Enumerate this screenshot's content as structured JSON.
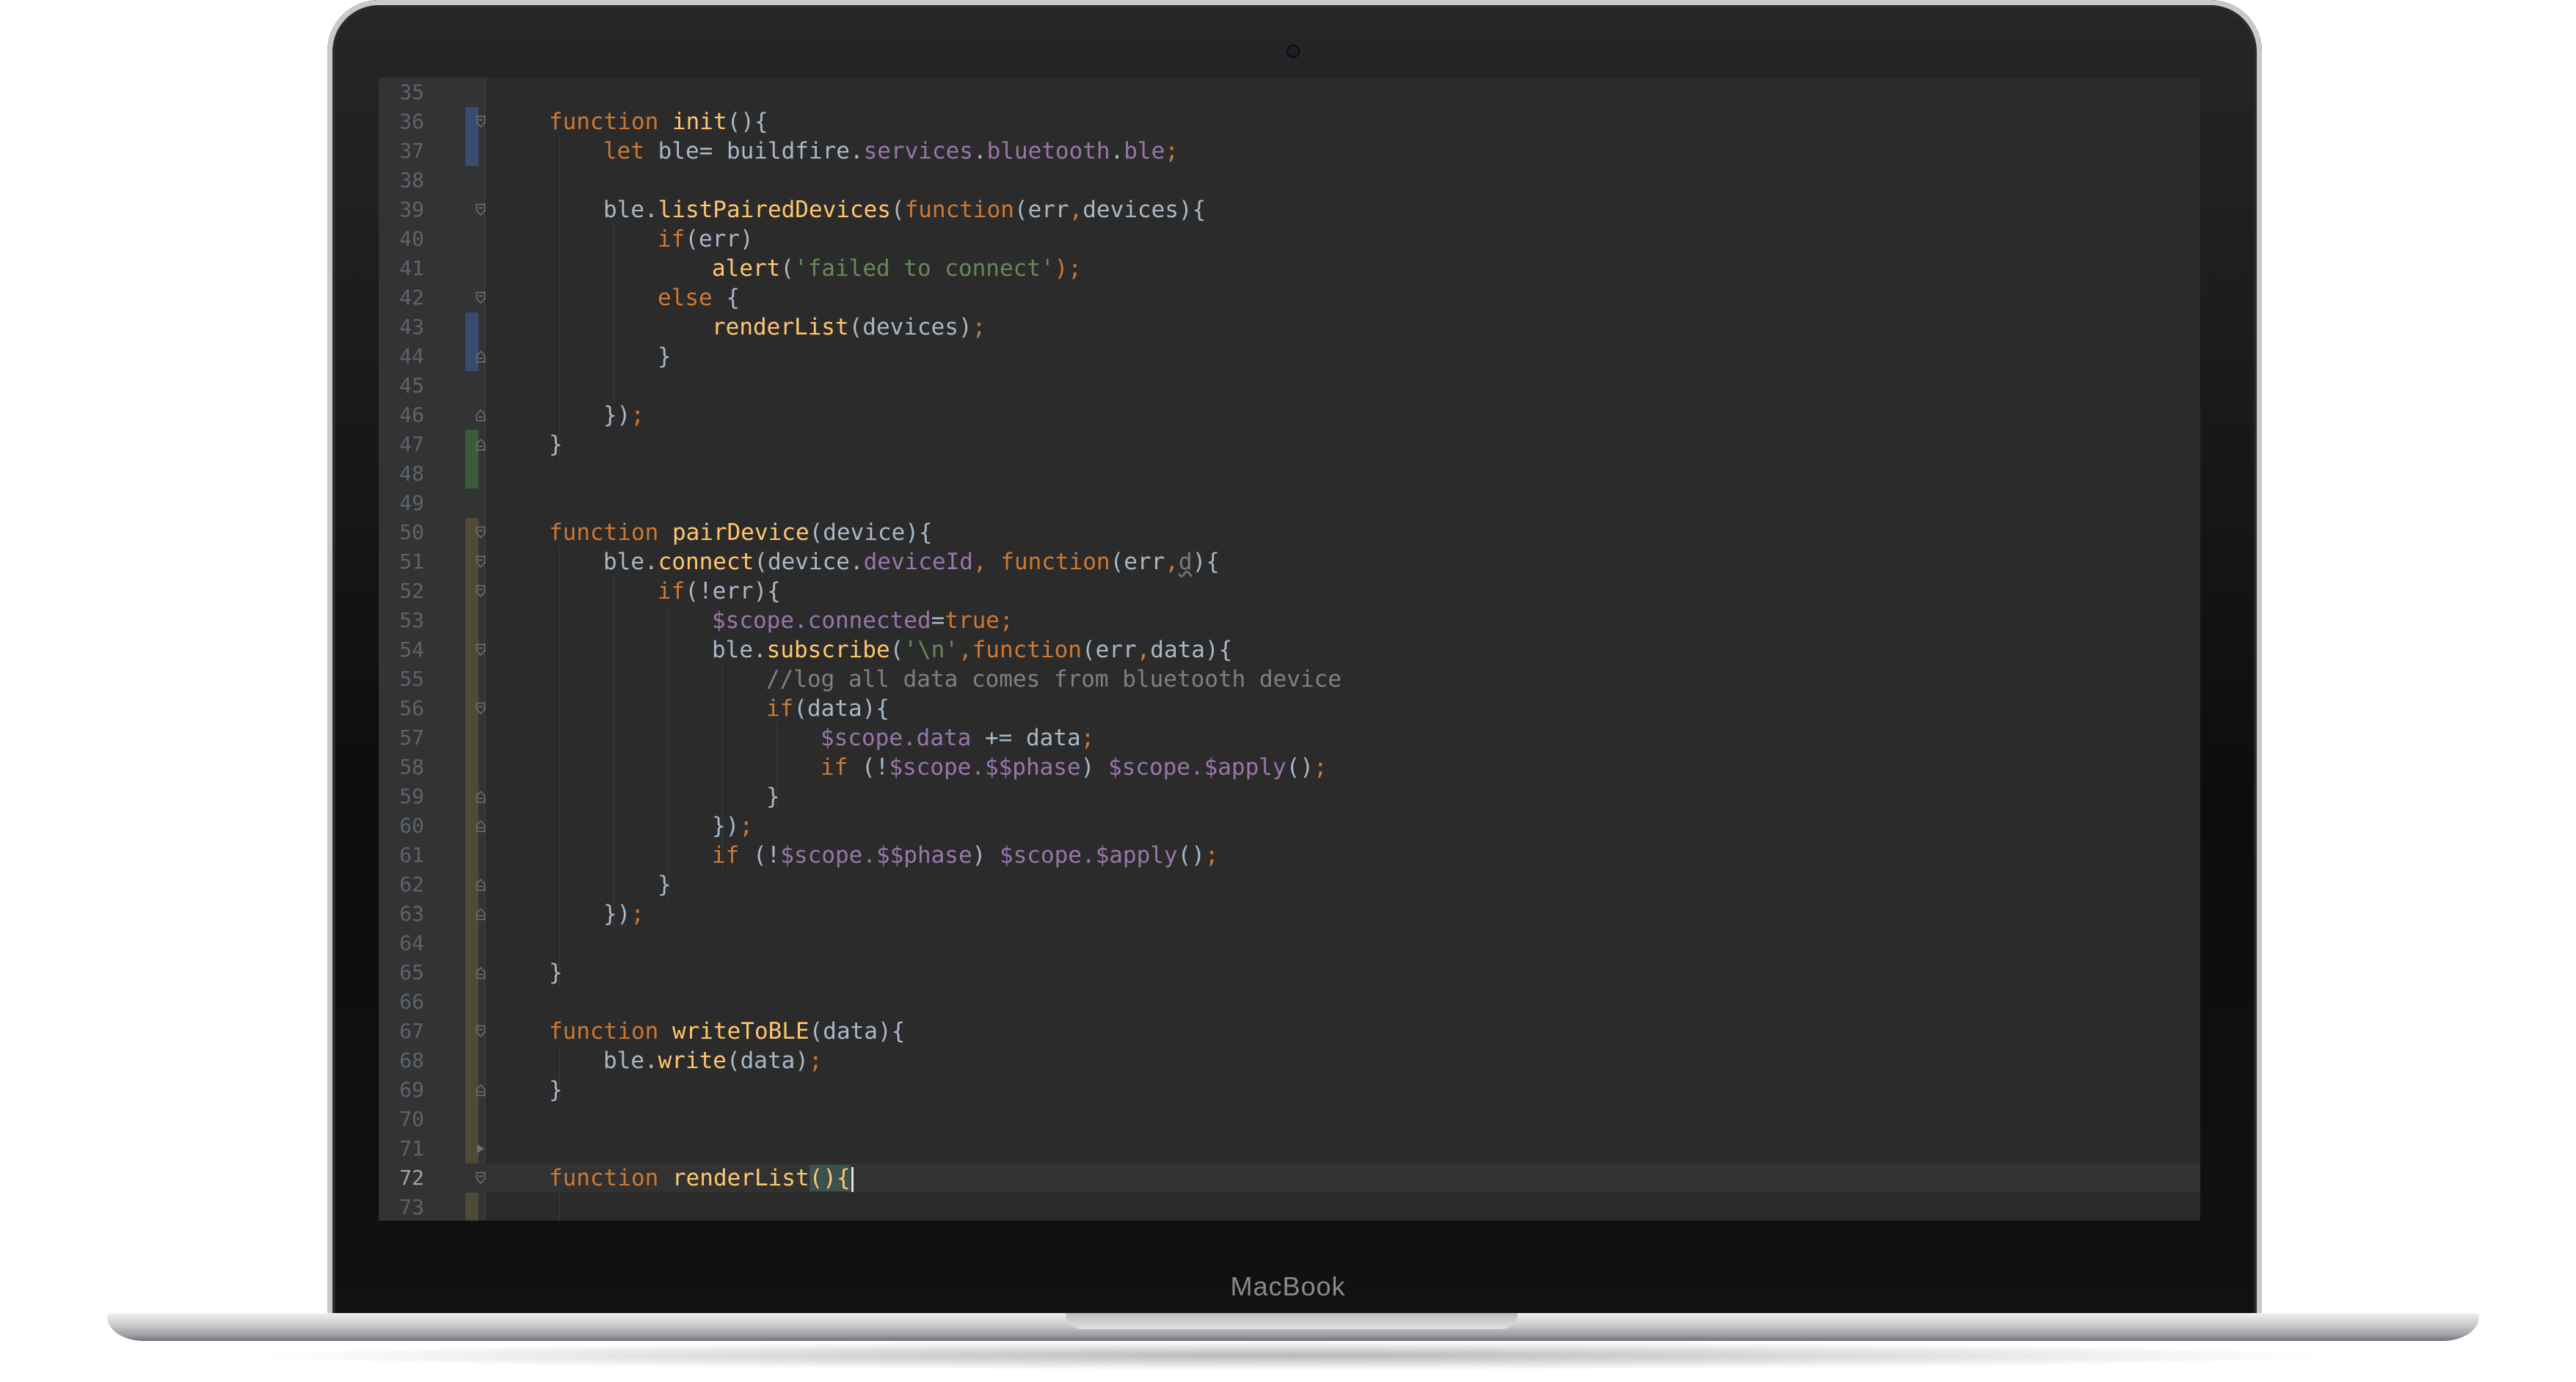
{
  "device": {
    "brand_label": "MacBook"
  },
  "editor": {
    "current_line": 72,
    "colors": {
      "background": "#2b2b2b",
      "keyword": "#cc7832",
      "function_name": "#ffc66d",
      "identifier": "#a9b7c6",
      "property": "#9876aa",
      "string": "#6a8759",
      "comment": "#808080"
    },
    "lines": [
      {
        "n": "35",
        "tokens": []
      },
      {
        "n": "36",
        "indent": 0,
        "fold": "open",
        "tokens": [
          {
            "t": "function ",
            "c": "kw"
          },
          {
            "t": "init",
            "c": "fn"
          },
          {
            "t": "(){",
            "c": "pl"
          }
        ]
      },
      {
        "n": "37",
        "indent": 1,
        "tokens": [
          {
            "t": "let ",
            "c": "kw"
          },
          {
            "t": "ble= buildfire.",
            "c": "pl"
          },
          {
            "t": "services",
            "c": "pr"
          },
          {
            "t": ".",
            "c": "pl"
          },
          {
            "t": "bluetooth",
            "c": "pr"
          },
          {
            "t": ".",
            "c": "pl"
          },
          {
            "t": "ble",
            "c": "pr"
          },
          {
            "t": ";",
            "c": "kw"
          }
        ]
      },
      {
        "n": "38",
        "tokens": []
      },
      {
        "n": "39",
        "indent": 1,
        "fold": "open",
        "tokens": [
          {
            "t": "ble.",
            "c": "pl"
          },
          {
            "t": "listPairedDevices",
            "c": "fn"
          },
          {
            "t": "(",
            "c": "pl"
          },
          {
            "t": "function",
            "c": "kw"
          },
          {
            "t": "(err",
            "c": "pl"
          },
          {
            "t": ",",
            "c": "kw"
          },
          {
            "t": "devices){",
            "c": "pl"
          }
        ]
      },
      {
        "n": "40",
        "indent": 2,
        "tokens": [
          {
            "t": "if",
            "c": "kw"
          },
          {
            "t": "(err)",
            "c": "pl"
          }
        ]
      },
      {
        "n": "41",
        "indent": 3,
        "tokens": [
          {
            "t": "alert",
            "c": "fn"
          },
          {
            "t": "(",
            "c": "pl"
          },
          {
            "t": "'failed to connect'",
            "c": "st"
          },
          {
            "t": ");",
            "c": "kw"
          }
        ]
      },
      {
        "n": "42",
        "indent": 2,
        "fold": "open",
        "tokens": [
          {
            "t": "else ",
            "c": "kw"
          },
          {
            "t": "{",
            "c": "pl"
          }
        ]
      },
      {
        "n": "43",
        "indent": 3,
        "tokens": [
          {
            "t": "renderList",
            "c": "fn"
          },
          {
            "t": "(devices)",
            "c": "pl"
          },
          {
            "t": ";",
            "c": "kw"
          }
        ]
      },
      {
        "n": "44",
        "indent": 2,
        "fold": "close",
        "tokens": [
          {
            "t": "}",
            "c": "pl"
          }
        ]
      },
      {
        "n": "45",
        "tokens": []
      },
      {
        "n": "46",
        "indent": 1,
        "fold": "close",
        "tokens": [
          {
            "t": "})",
            "c": "pl"
          },
          {
            "t": ";",
            "c": "kw"
          }
        ]
      },
      {
        "n": "47",
        "indent": 0,
        "fold": "close",
        "tokens": [
          {
            "t": "}",
            "c": "pl"
          }
        ]
      },
      {
        "n": "48",
        "tokens": []
      },
      {
        "n": "49",
        "tokens": []
      },
      {
        "n": "50",
        "indent": 0,
        "fold": "open",
        "tokens": [
          {
            "t": "function ",
            "c": "kw"
          },
          {
            "t": "pairDevice",
            "c": "fn"
          },
          {
            "t": "(device){",
            "c": "pl"
          }
        ]
      },
      {
        "n": "51",
        "indent": 1,
        "fold": "open",
        "tokens": [
          {
            "t": "ble.",
            "c": "pl"
          },
          {
            "t": "connect",
            "c": "fn"
          },
          {
            "t": "(device.",
            "c": "pl"
          },
          {
            "t": "deviceId",
            "c": "pr"
          },
          {
            "t": ", ",
            "c": "kw"
          },
          {
            "t": "function",
            "c": "kw"
          },
          {
            "t": "(err",
            "c": "pl"
          },
          {
            "t": ",",
            "c": "kw"
          },
          {
            "t": "d",
            "c": "dim"
          },
          {
            "t": "){",
            "c": "pl"
          }
        ]
      },
      {
        "n": "52",
        "indent": 2,
        "fold": "open",
        "tokens": [
          {
            "t": "if",
            "c": "kw"
          },
          {
            "t": "(!err){",
            "c": "pl"
          }
        ]
      },
      {
        "n": "53",
        "indent": 3,
        "tokens": [
          {
            "t": "$scope.",
            "c": "pr"
          },
          {
            "t": "connected",
            "c": "pr"
          },
          {
            "t": "=",
            "c": "pl"
          },
          {
            "t": "true",
            "c": "kw"
          },
          {
            "t": ";",
            "c": "kw"
          }
        ]
      },
      {
        "n": "54",
        "indent": 3,
        "fold": "open",
        "tokens": [
          {
            "t": "ble.",
            "c": "pl"
          },
          {
            "t": "subscribe",
            "c": "fn"
          },
          {
            "t": "(",
            "c": "pl"
          },
          {
            "t": "'\\n'",
            "c": "st"
          },
          {
            "t": ",",
            "c": "kw"
          },
          {
            "t": "function",
            "c": "kw"
          },
          {
            "t": "(err",
            "c": "pl"
          },
          {
            "t": ",",
            "c": "kw"
          },
          {
            "t": "data){",
            "c": "pl"
          }
        ]
      },
      {
        "n": "55",
        "indent": 4,
        "tokens": [
          {
            "t": "//log all data comes from bluetooth device",
            "c": "cm"
          }
        ]
      },
      {
        "n": "56",
        "indent": 4,
        "fold": "open",
        "tokens": [
          {
            "t": "if",
            "c": "kw"
          },
          {
            "t": "(data){",
            "c": "pl"
          }
        ]
      },
      {
        "n": "57",
        "indent": 5,
        "tokens": [
          {
            "t": "$scope.",
            "c": "pr"
          },
          {
            "t": "data",
            "c": "pr"
          },
          {
            "t": " += data",
            "c": "pl"
          },
          {
            "t": ";",
            "c": "kw"
          }
        ]
      },
      {
        "n": "58",
        "indent": 5,
        "tokens": [
          {
            "t": "if ",
            "c": "kw"
          },
          {
            "t": "(!",
            "c": "pl"
          },
          {
            "t": "$scope.$$phase",
            "c": "pr"
          },
          {
            "t": ") ",
            "c": "pl"
          },
          {
            "t": "$scope.$apply",
            "c": "pr"
          },
          {
            "t": "()",
            "c": "pl"
          },
          {
            "t": ";",
            "c": "kw"
          }
        ]
      },
      {
        "n": "59",
        "indent": 4,
        "fold": "close",
        "tokens": [
          {
            "t": "}",
            "c": "pl"
          }
        ]
      },
      {
        "n": "60",
        "indent": 3,
        "fold": "close",
        "tokens": [
          {
            "t": "})",
            "c": "pl"
          },
          {
            "t": ";",
            "c": "kw"
          }
        ]
      },
      {
        "n": "61",
        "indent": 3,
        "tokens": [
          {
            "t": "if ",
            "c": "kw"
          },
          {
            "t": "(!",
            "c": "pl"
          },
          {
            "t": "$scope.$$phase",
            "c": "pr"
          },
          {
            "t": ") ",
            "c": "pl"
          },
          {
            "t": "$scope.$apply",
            "c": "pr"
          },
          {
            "t": "()",
            "c": "pl"
          },
          {
            "t": ";",
            "c": "kw"
          }
        ]
      },
      {
        "n": "62",
        "indent": 2,
        "fold": "close",
        "tokens": [
          {
            "t": "}",
            "c": "pl"
          }
        ]
      },
      {
        "n": "63",
        "indent": 1,
        "fold": "close",
        "tokens": [
          {
            "t": "})",
            "c": "pl"
          },
          {
            "t": ";",
            "c": "kw"
          }
        ]
      },
      {
        "n": "64",
        "tokens": []
      },
      {
        "n": "65",
        "indent": 0,
        "fold": "close",
        "tokens": [
          {
            "t": "}",
            "c": "pl"
          }
        ]
      },
      {
        "n": "66",
        "tokens": []
      },
      {
        "n": "67",
        "indent": 0,
        "fold": "open",
        "tokens": [
          {
            "t": "function ",
            "c": "kw"
          },
          {
            "t": "writeToBLE",
            "c": "fn"
          },
          {
            "t": "(data){",
            "c": "pl"
          }
        ]
      },
      {
        "n": "68",
        "indent": 1,
        "tokens": [
          {
            "t": "ble.",
            "c": "pl"
          },
          {
            "t": "write",
            "c": "fn"
          },
          {
            "t": "(data)",
            "c": "pl"
          },
          {
            "t": ";",
            "c": "kw"
          }
        ]
      },
      {
        "n": "69",
        "indent": 0,
        "fold": "close",
        "tokens": [
          {
            "t": "}",
            "c": "pl"
          }
        ]
      },
      {
        "n": "70",
        "tokens": []
      },
      {
        "n": "71",
        "fold": "arrow",
        "tokens": []
      },
      {
        "n": "72",
        "indent": 0,
        "fold": "open",
        "tokens": [
          {
            "t": "function ",
            "c": "kw"
          },
          {
            "t": "renderList",
            "c": "fn"
          },
          {
            "t": "()",
            "c": "hl"
          },
          {
            "t": "{",
            "c": "hl"
          }
        ]
      },
      {
        "n": "73",
        "tokens": []
      }
    ]
  }
}
